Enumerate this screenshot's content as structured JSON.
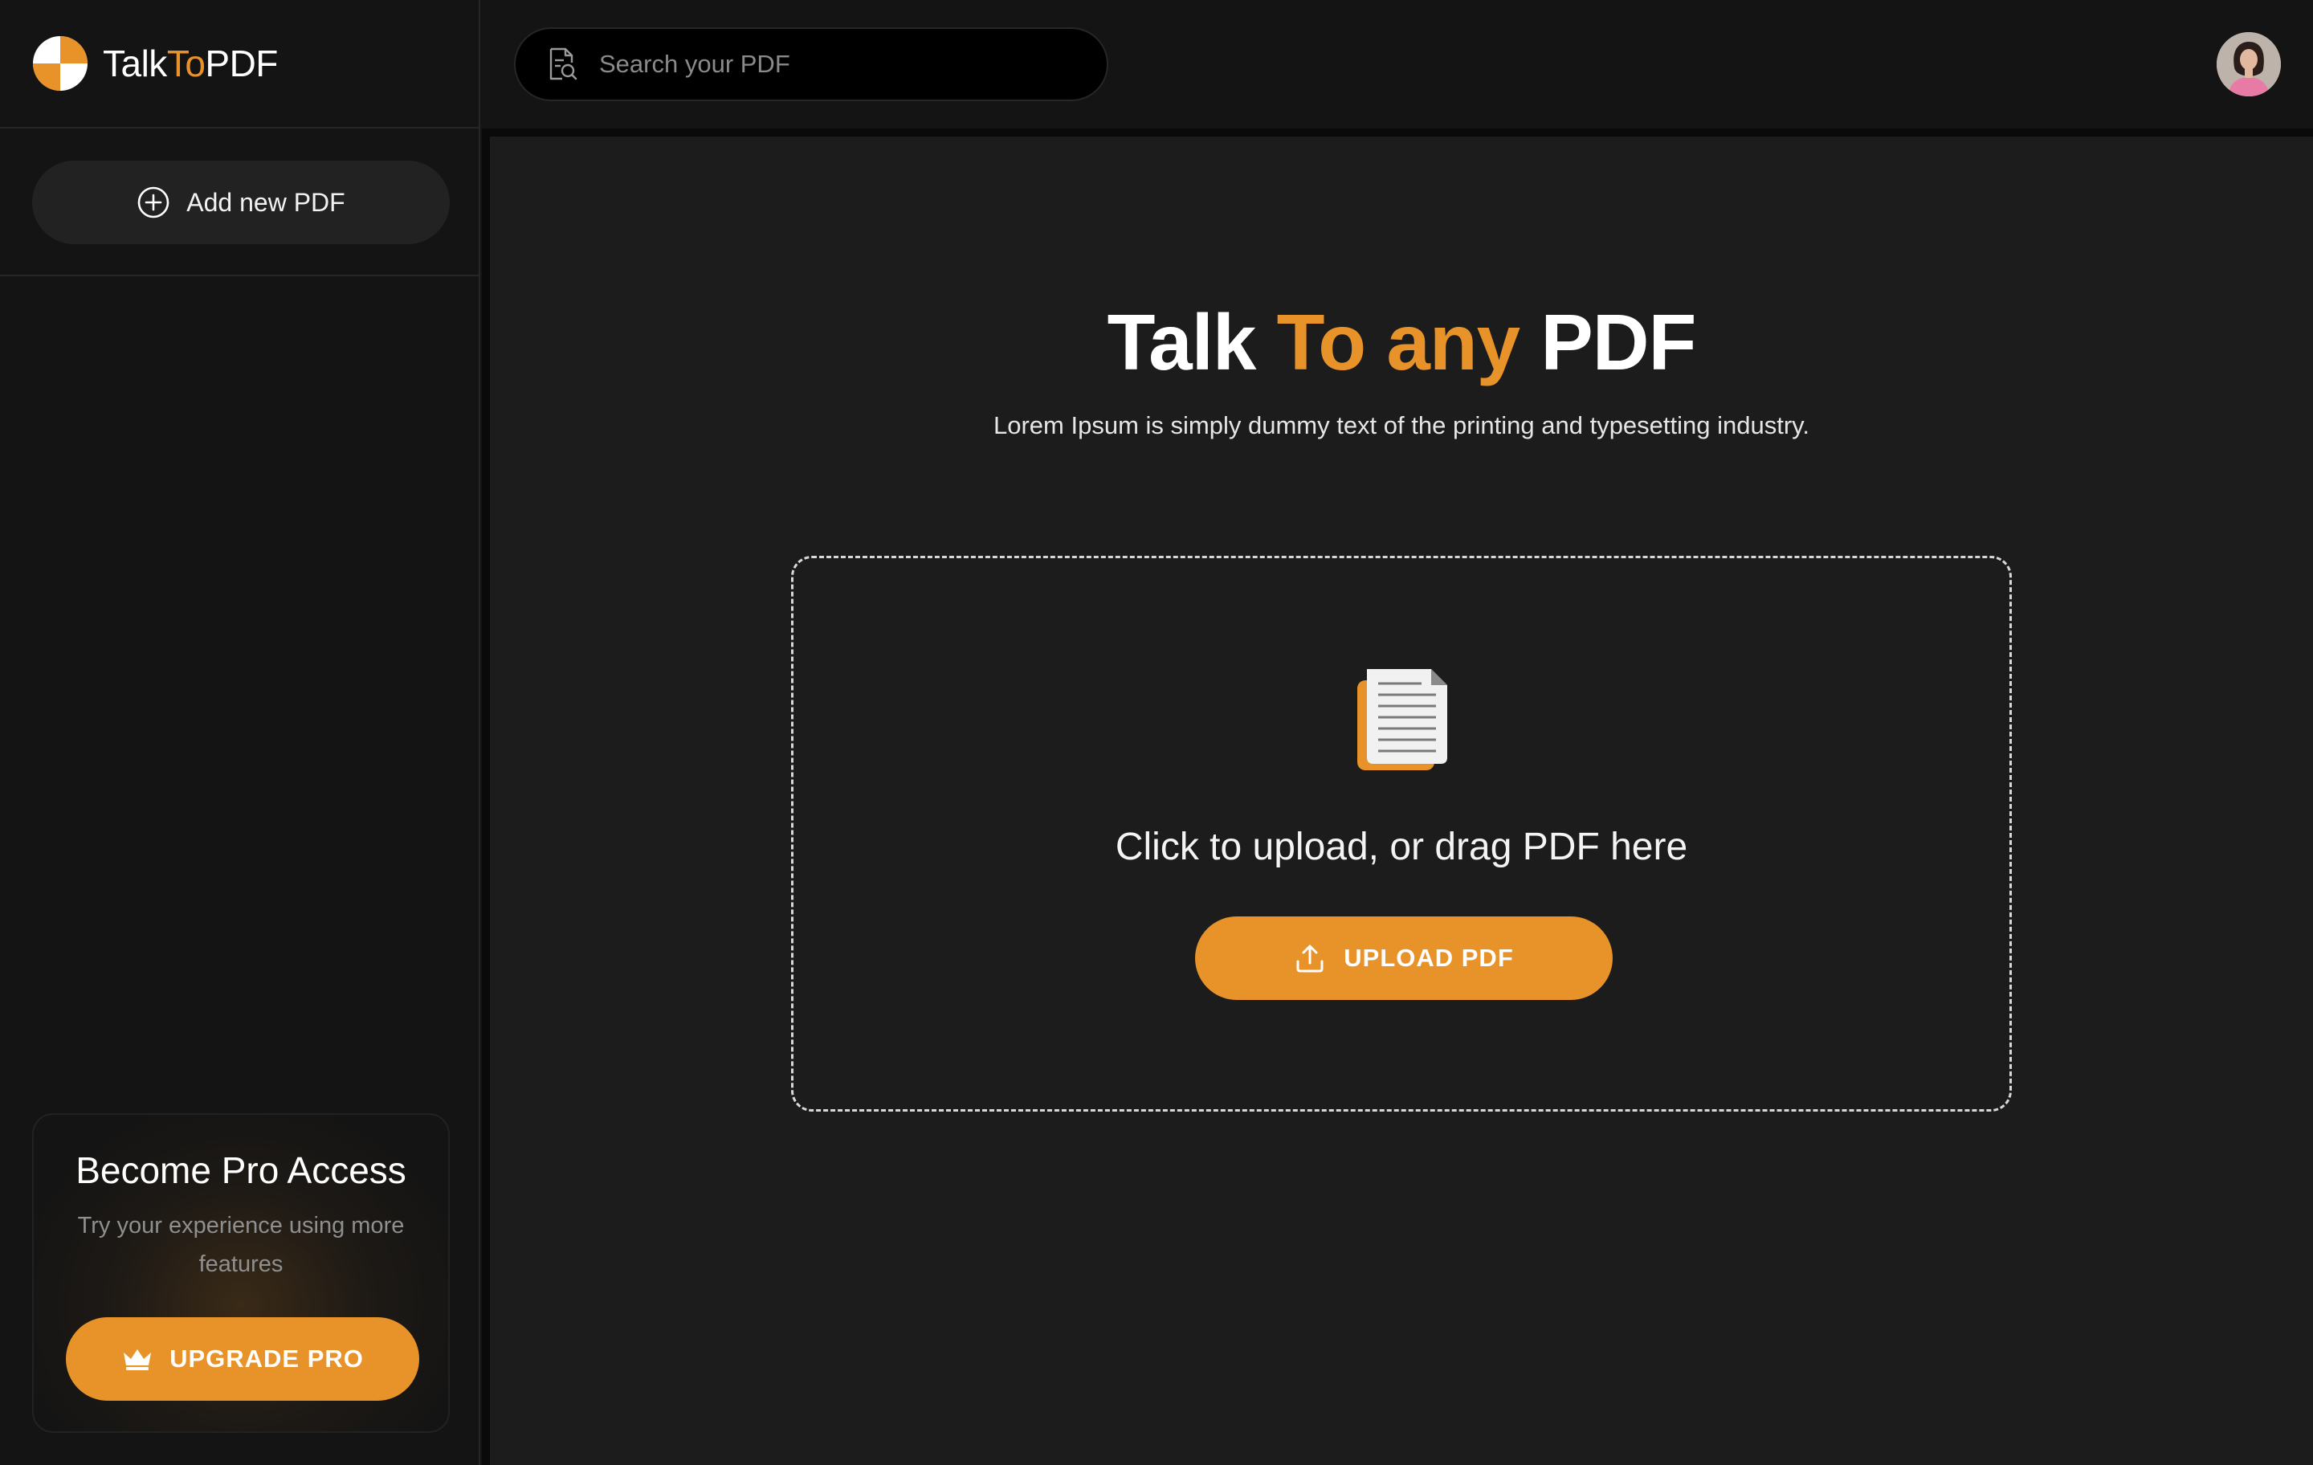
{
  "brand": {
    "name_part1": "Talk",
    "name_accent": "To",
    "name_part2": "PDF",
    "accent_color": "#e8922a",
    "logo_icon": "quartered-circle-logo"
  },
  "sidebar": {
    "add_button_label": "Add new PDF",
    "add_button_icon": "plus-circle-icon",
    "pro_card": {
      "title": "Become Pro Access",
      "subtitle": "Try your experience using more features",
      "button_label": "UPGRADE PRO",
      "button_icon": "crown-icon"
    }
  },
  "topbar": {
    "search_placeholder": "Search your PDF",
    "search_icon": "document-search-icon",
    "avatar": "user-avatar"
  },
  "main": {
    "headline_part1": "Talk ",
    "headline_accent": "To any",
    "headline_part2": " PDF",
    "subline": "Lorem Ipsum is simply dummy text of the printing and typesetting industry.",
    "dropzone": {
      "icon": "document-icon",
      "text": "Click to upload, or drag PDF here",
      "button_label": "UPLOAD PDF",
      "button_icon": "upload-icon"
    }
  }
}
